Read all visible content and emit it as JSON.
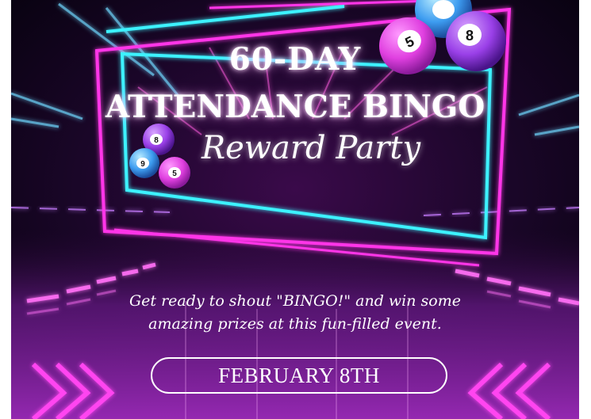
{
  "poster": {
    "title_line1": "60-DAY",
    "title_line2": "ATTENDANCE BINGO",
    "subtitle": "Reward Party",
    "tagline_line1": "Get ready to shout \"BINGO!\" and win some",
    "tagline_line2": "amazing prizes at this fun-filled event.",
    "date": "FEBRUARY 8TH"
  },
  "bingo_balls": {
    "large_left": "5",
    "large_right": "8",
    "small_top": "8",
    "small_left": "9",
    "small_right": "5"
  },
  "colors": {
    "background": "#1a0628",
    "neon_pink": "#ff3bf2",
    "neon_cyan": "#3cf2ff",
    "neon_purple": "#b84dff",
    "text": "#ffffff"
  }
}
